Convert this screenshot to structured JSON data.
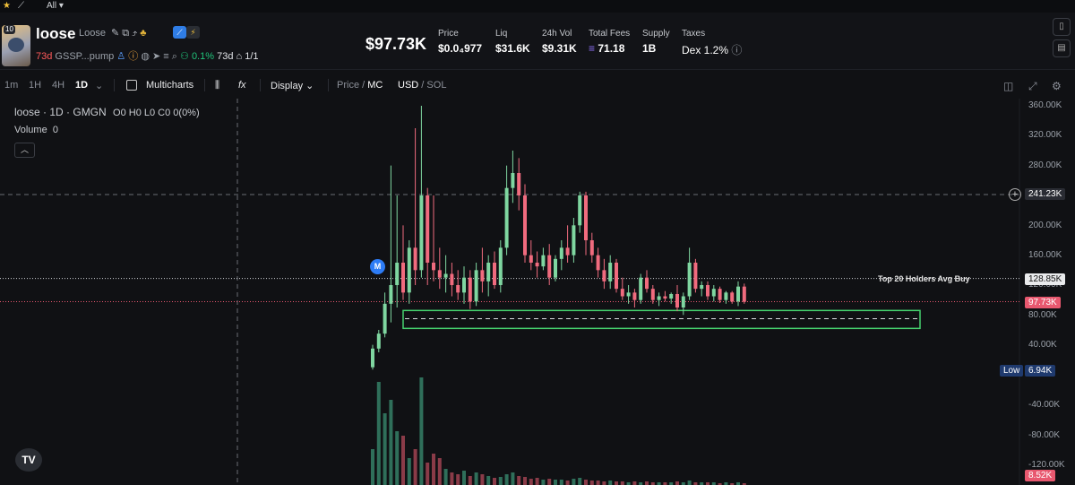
{
  "topbar": {
    "star_icon": "star-icon",
    "chart_icon": "chart-icon",
    "filter_label": "All"
  },
  "token": {
    "name": "loose",
    "ticker": "Loose",
    "badge": "10",
    "age": "73d",
    "address": "GSSP...pump",
    "holder_change": "0.1%",
    "holder_age": "73d",
    "ratio": "1/1"
  },
  "stats": {
    "mc": "$97.73K",
    "price_label": "Price",
    "price_value": "$0.0₄977",
    "liq_label": "Liq",
    "liq_value": "$31.6K",
    "vol_label": "24h Vol",
    "vol_value": "$9.31K",
    "fees_label": "Total Fees",
    "fees_value": "71.18",
    "supply_label": "Supply",
    "supply_value": "1B",
    "taxes_label": "Taxes",
    "taxes_value": "Dex 1.2%"
  },
  "toolbar": {
    "tf_1m": "1m",
    "tf_1h": "1H",
    "tf_4h": "4H",
    "tf_1d": "1D",
    "multicharts": "Multicharts",
    "display": "Display",
    "price": "Price",
    "slash1": "/",
    "mc": "MC",
    "usd": "USD",
    "slash2": "/",
    "sol": "SOL"
  },
  "legend": {
    "title": "loose · 1D · GMGN",
    "ohlc": "O0 H0 L0 C0 0(0%)",
    "volume": "Volume",
    "volume_value": "0"
  },
  "axis": {
    "labels": [
      "360.00K",
      "320.00K",
      "280.00K",
      "240.00K",
      "200.00K",
      "160.00K",
      "120.00K",
      "80.00K",
      "40.00K",
      "-40.00K",
      "-80.00K",
      "-120.00K"
    ],
    "tag_crosshair": "241.23K",
    "tag_avgbuy": "128.85K",
    "tag_current": "97.73K",
    "tag_low_label": "Low",
    "tag_low_value": "6.94K",
    "tag_volume": "8.52K"
  },
  "annotations": {
    "avg_buy": "Top 20 Holders Avg Buy",
    "marker": "M",
    "tv": "TV"
  },
  "colors": {
    "up": "#7fd6a0",
    "down": "#f06b7e",
    "vol_up": "#2f6f5a",
    "vol_down": "#8a3b48",
    "accent": "#2d7cf6",
    "box": "#46d36f"
  },
  "chart_data": {
    "type": "candlestick",
    "ylim": [
      -120000,
      360000
    ],
    "candles": [
      {
        "o": 10000,
        "h": 40000,
        "l": 6940,
        "c": 35000
      },
      {
        "o": 35000,
        "h": 60000,
        "l": 30000,
        "c": 55000
      },
      {
        "o": 55000,
        "h": 110000,
        "l": 50000,
        "c": 95000
      },
      {
        "o": 95000,
        "h": 280000,
        "l": 70000,
        "c": 120000
      },
      {
        "o": 120000,
        "h": 240000,
        "l": 90000,
        "c": 150000
      },
      {
        "o": 150000,
        "h": 200000,
        "l": 100000,
        "c": 110000
      },
      {
        "o": 110000,
        "h": 180000,
        "l": 95000,
        "c": 170000
      },
      {
        "o": 170000,
        "h": 330000,
        "l": 120000,
        "c": 140000
      },
      {
        "o": 140000,
        "h": 360000,
        "l": 130000,
        "c": 240000
      },
      {
        "o": 240000,
        "h": 250000,
        "l": 120000,
        "c": 150000
      },
      {
        "o": 150000,
        "h": 240000,
        "l": 125000,
        "c": 140000
      },
      {
        "o": 140000,
        "h": 170000,
        "l": 115000,
        "c": 130000
      },
      {
        "o": 130000,
        "h": 160000,
        "l": 110000,
        "c": 135000
      },
      {
        "o": 135000,
        "h": 150000,
        "l": 105000,
        "c": 120000
      },
      {
        "o": 120000,
        "h": 140000,
        "l": 100000,
        "c": 110000
      },
      {
        "o": 110000,
        "h": 145000,
        "l": 95000,
        "c": 130000
      },
      {
        "o": 130000,
        "h": 140000,
        "l": 88000,
        "c": 98000
      },
      {
        "o": 98000,
        "h": 150000,
        "l": 92000,
        "c": 140000
      },
      {
        "o": 140000,
        "h": 170000,
        "l": 110000,
        "c": 125000
      },
      {
        "o": 125000,
        "h": 160000,
        "l": 105000,
        "c": 150000
      },
      {
        "o": 150000,
        "h": 165000,
        "l": 115000,
        "c": 120000
      },
      {
        "o": 120000,
        "h": 180000,
        "l": 110000,
        "c": 170000
      },
      {
        "o": 170000,
        "h": 280000,
        "l": 160000,
        "c": 250000
      },
      {
        "o": 250000,
        "h": 300000,
        "l": 230000,
        "c": 270000
      },
      {
        "o": 270000,
        "h": 290000,
        "l": 220000,
        "c": 240000
      },
      {
        "o": 240000,
        "h": 255000,
        "l": 150000,
        "c": 160000
      },
      {
        "o": 160000,
        "h": 180000,
        "l": 140000,
        "c": 150000
      },
      {
        "o": 150000,
        "h": 165000,
        "l": 130000,
        "c": 145000
      },
      {
        "o": 145000,
        "h": 170000,
        "l": 140000,
        "c": 160000
      },
      {
        "o": 160000,
        "h": 175000,
        "l": 120000,
        "c": 130000
      },
      {
        "o": 130000,
        "h": 160000,
        "l": 125000,
        "c": 155000
      },
      {
        "o": 155000,
        "h": 180000,
        "l": 140000,
        "c": 170000
      },
      {
        "o": 170000,
        "h": 200000,
        "l": 150000,
        "c": 160000
      },
      {
        "o": 160000,
        "h": 210000,
        "l": 150000,
        "c": 200000
      },
      {
        "o": 200000,
        "h": 245000,
        "l": 190000,
        "c": 240000
      },
      {
        "o": 240000,
        "h": 245000,
        "l": 160000,
        "c": 180000
      },
      {
        "o": 180000,
        "h": 190000,
        "l": 150000,
        "c": 160000
      },
      {
        "o": 160000,
        "h": 170000,
        "l": 130000,
        "c": 140000
      },
      {
        "o": 140000,
        "h": 155000,
        "l": 115000,
        "c": 125000
      },
      {
        "o": 125000,
        "h": 160000,
        "l": 115000,
        "c": 150000
      },
      {
        "o": 150000,
        "h": 155000,
        "l": 110000,
        "c": 115000
      },
      {
        "o": 115000,
        "h": 130000,
        "l": 100000,
        "c": 105000
      },
      {
        "o": 105000,
        "h": 120000,
        "l": 95000,
        "c": 110000
      },
      {
        "o": 110000,
        "h": 115000,
        "l": 90000,
        "c": 100000
      },
      {
        "o": 100000,
        "h": 135000,
        "l": 95000,
        "c": 130000
      },
      {
        "o": 130000,
        "h": 140000,
        "l": 110000,
        "c": 115000
      },
      {
        "o": 115000,
        "h": 120000,
        "l": 95000,
        "c": 100000
      },
      {
        "o": 100000,
        "h": 110000,
        "l": 92000,
        "c": 105000
      },
      {
        "o": 105000,
        "h": 112000,
        "l": 98000,
        "c": 102000
      },
      {
        "o": 102000,
        "h": 110000,
        "l": 95000,
        "c": 108000
      },
      {
        "o": 108000,
        "h": 120000,
        "l": 85000,
        "c": 90000
      },
      {
        "o": 90000,
        "h": 110000,
        "l": 80000,
        "c": 105000
      },
      {
        "o": 105000,
        "h": 170000,
        "l": 100000,
        "c": 150000
      },
      {
        "o": 150000,
        "h": 155000,
        "l": 110000,
        "c": 115000
      },
      {
        "o": 115000,
        "h": 125000,
        "l": 105000,
        "c": 120000
      },
      {
        "o": 120000,
        "h": 125000,
        "l": 100000,
        "c": 105000
      },
      {
        "o": 105000,
        "h": 120000,
        "l": 98000,
        "c": 115000
      },
      {
        "o": 115000,
        "h": 118000,
        "l": 96000,
        "c": 100000
      },
      {
        "o": 100000,
        "h": 112000,
        "l": 95000,
        "c": 110000
      },
      {
        "o": 110000,
        "h": 112000,
        "l": 95000,
        "c": 98000
      },
      {
        "o": 98000,
        "h": 125000,
        "l": 92000,
        "c": 118000
      },
      {
        "o": 118000,
        "h": 122000,
        "l": 95000,
        "c": 97730
      }
    ],
    "volumes": [
      40,
      115,
      80,
      95,
      60,
      55,
      30,
      40,
      120,
      25,
      35,
      30,
      18,
      14,
      12,
      16,
      10,
      14,
      12,
      10,
      8,
      9,
      12,
      14,
      10,
      9,
      7,
      8,
      6,
      7,
      6,
      6,
      5,
      7,
      8,
      6,
      5,
      5,
      4,
      5,
      4,
      4,
      3,
      4,
      3,
      4,
      3,
      3,
      3,
      3,
      4,
      3,
      5,
      3,
      3,
      3,
      3,
      2,
      3,
      2,
      3,
      2
    ],
    "levels": {
      "avg_buy": 128850,
      "current": 97730,
      "crosshair": 241230,
      "support_low": 62000,
      "support_high": 86000,
      "support_mid": 75000
    }
  }
}
